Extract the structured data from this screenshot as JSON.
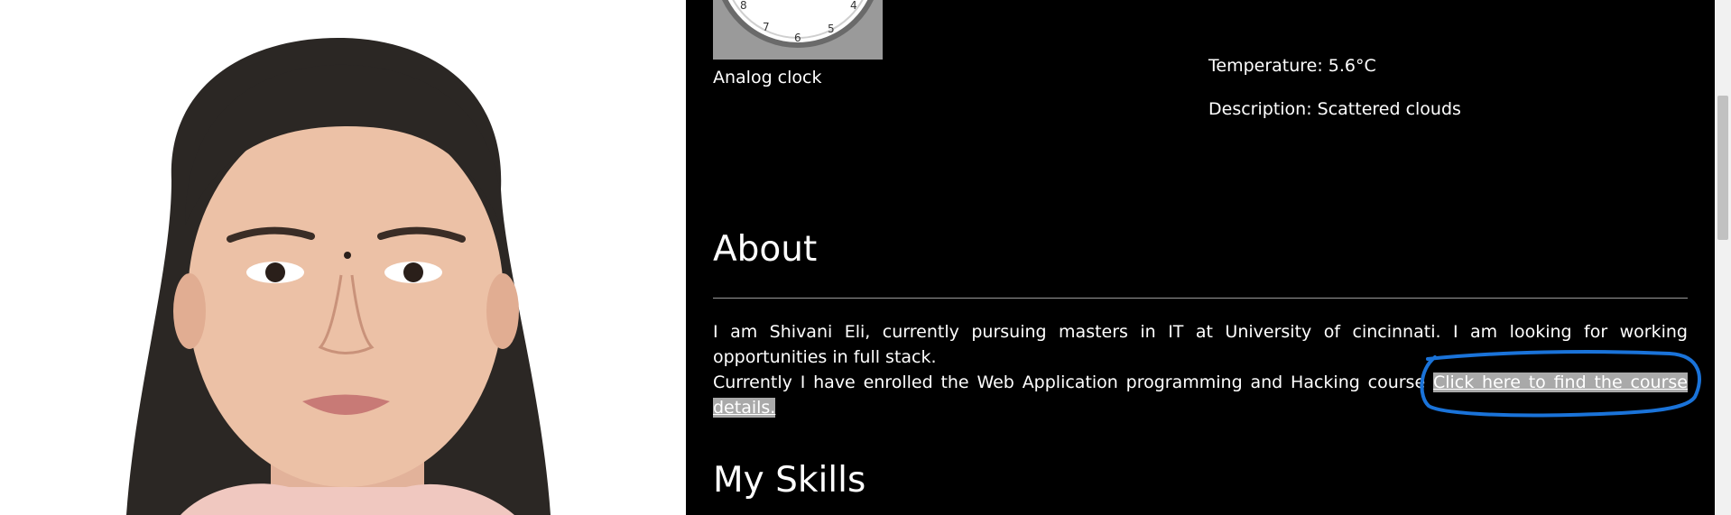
{
  "portrait": {
    "icon": "person-photo"
  },
  "clock": {
    "caption": "Analog clock",
    "numerals": [
      "8",
      "7",
      "6",
      "5",
      "4"
    ]
  },
  "weather": {
    "temperature": "Temperature: 5.6°C",
    "description": "Description: Scattered clouds"
  },
  "about": {
    "heading": "About",
    "paragraph1": "I am Shivani Eli, currently pursuing masters in IT at University of cincinnati. I am looking for working opportunities in full stack.",
    "paragraph2_text": "Currently I have enrolled the Web Application programming and Hacking course ",
    "course_link": "Click here to find the course details."
  },
  "skills": {
    "heading": "My Skills"
  },
  "colors": {
    "panel_bg": "#000000",
    "text": "#ffffff",
    "link_highlight": "#a9a9a9",
    "annotation": "#1a73d9"
  }
}
